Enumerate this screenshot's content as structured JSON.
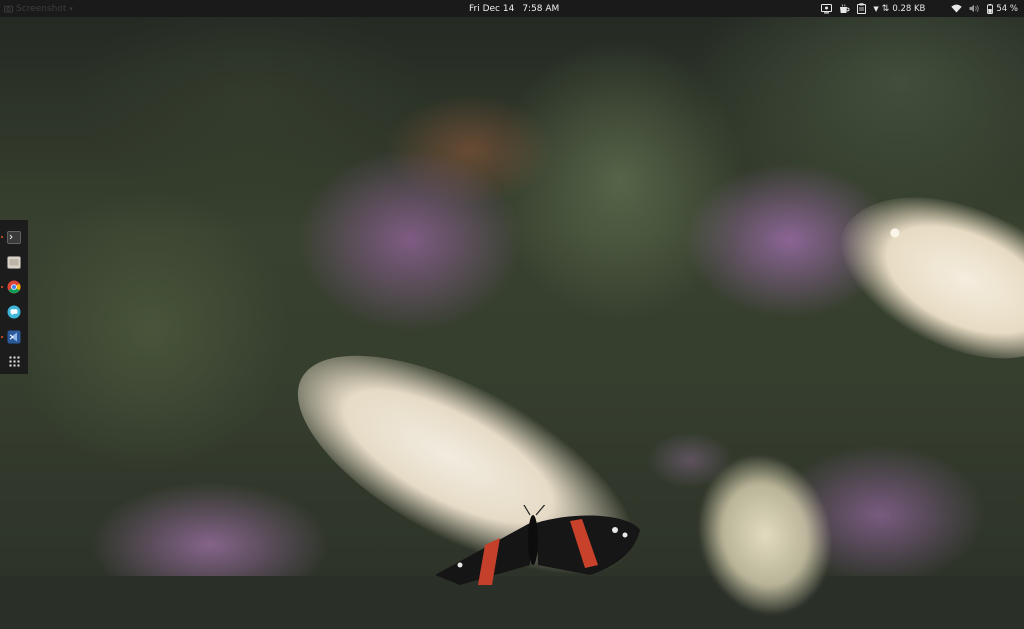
{
  "topbar": {
    "app_menu_label": "Screenshot",
    "date": "Fri Dec 14",
    "time": "7:58 AM",
    "network_speed": "0.28 KB",
    "battery_percent": "54 %"
  },
  "tray_icons": [
    "screen-icon",
    "coffee-icon",
    "clipboard-icon",
    "chevron-down-icon",
    "network-arrows-icon",
    "wifi-icon",
    "volume-icon",
    "battery-icon"
  ],
  "dock": {
    "items": [
      {
        "name": "terminal",
        "icon": "terminal-icon",
        "running": true
      },
      {
        "name": "files",
        "icon": "files-icon",
        "running": false
      },
      {
        "name": "chrome",
        "icon": "chrome-icon",
        "running": true
      },
      {
        "name": "messaging",
        "icon": "chat-icon",
        "running": false
      },
      {
        "name": "vscode",
        "icon": "vscode-icon",
        "running": true
      },
      {
        "name": "show-applications",
        "icon": "app-grid-icon",
        "running": false
      }
    ]
  },
  "colors": {
    "topbar_bg": "#1a1a1a",
    "dock_bg": "#1c1c1c",
    "running_indicator": "#e95420"
  }
}
